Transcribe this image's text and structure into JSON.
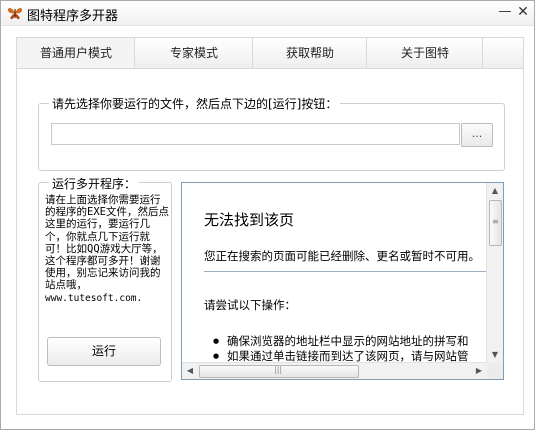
{
  "window": {
    "title": "图特程序多开器",
    "minimize_glyph": "—",
    "close_glyph": "✕"
  },
  "tabs": [
    {
      "label": "普通用户模式",
      "active": true
    },
    {
      "label": "专家模式",
      "active": false
    },
    {
      "label": "获取帮助",
      "active": false
    },
    {
      "label": "关于图特",
      "active": false
    }
  ],
  "select_group": {
    "legend": "请先选择你要运行的文件，然后点下边的[运行]按钮：",
    "path_value": "",
    "browse_label": "..."
  },
  "run_group": {
    "legend": "运行多开程序：",
    "description": "请在上面选择你需要运行的程序的EXE文件，然后点这里的运行，要运行几个，你就点几下运行就可！比如QQ游戏大厅等，这个程序都可多开！谢谢使用，别忘记来访问我的站点哦，",
    "site": "www.tutesoft.com.",
    "run_label": "运行"
  },
  "browser": {
    "heading": "无法找到该页",
    "subtext": "您正在搜索的页面可能已经删除、更名或暂时不可用。",
    "try_label": "请尝试以下操作：",
    "bullets": [
      "确保浏览器的地址栏中显示的网站地址的拼写和",
      "如果通过单击链接而到达了该网页，请与网站管"
    ]
  },
  "icons": {
    "app": "butterfly-icon",
    "scroll_up": "scroll-up-arrow-icon",
    "scroll_down": "scroll-down-arrow-icon",
    "scroll_left": "scroll-left-arrow-icon",
    "scroll_right": "scroll-right-arrow-icon"
  },
  "colors": {
    "app_icon": "#d2691e",
    "browser_border": "#7f9db9"
  }
}
